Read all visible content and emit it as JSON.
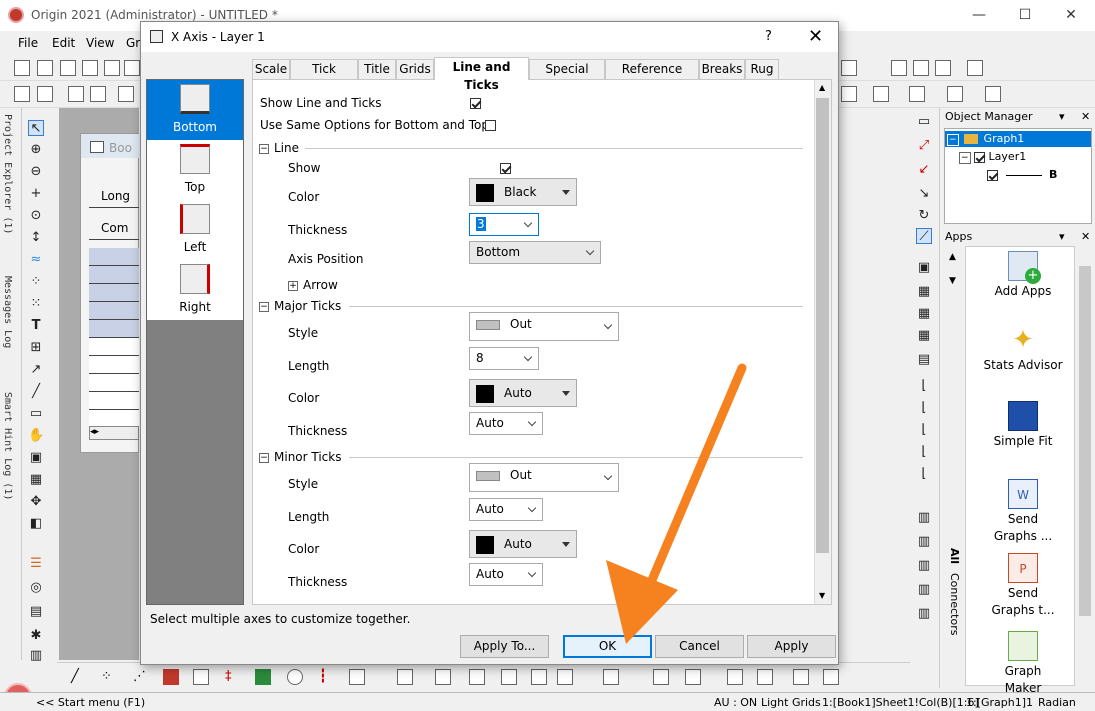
{
  "app": {
    "title": "Origin 2021 (Administrator) - UNTITLED *",
    "window_controls": [
      "—",
      "☐",
      "✕"
    ]
  },
  "menu": {
    "items": [
      "File",
      "Edit",
      "View",
      "Gra"
    ]
  },
  "vertical_tabs": [
    "Project Explorer (1)",
    "Messages Log",
    "Smart Hint Log (1)"
  ],
  "workbook": {
    "title": "Boo",
    "rows": [
      "Long",
      "Com"
    ]
  },
  "object_manager": {
    "title": "Object Manager",
    "controls": [
      "▾",
      "✕"
    ],
    "tree": {
      "graph": "Graph1",
      "layer": "Layer1",
      "plot": "B"
    }
  },
  "apps_panel": {
    "title": "Apps",
    "controls": [
      "▾",
      "✕"
    ],
    "tab_all": "All",
    "tab_connectors": "Connectors",
    "items": [
      "Add Apps",
      "Stats Advisor",
      "Simple Fit",
      "Send Graphs ...",
      "Send Graphs t...",
      "Graph Maker"
    ]
  },
  "status": {
    "start_menu": "<< Start menu (F1)",
    "au": "AU : ON",
    "grids": "Light Grids",
    "col": "1:[Book1]Sheet1!Col(B)[1:6]",
    "graph": "1:[Graph1]1",
    "units": "Radian"
  },
  "dialog": {
    "title": "X Axis - Layer 1",
    "help": "?",
    "close": "✕",
    "axes": [
      "Bottom",
      "Top",
      "Left",
      "Right"
    ],
    "selected_axis": "Bottom",
    "tabs": [
      "Scale",
      "Tick Labels",
      "Title",
      "Grids",
      "Line and Ticks",
      "Special Ticks",
      "Reference Lines",
      "Breaks",
      "Rug"
    ],
    "active_tab": "Line and Ticks",
    "options": {
      "show_line_and_ticks": "Show Line and Ticks",
      "same_options": "Use Same Options for Bottom and Top"
    },
    "line": {
      "section": "Line",
      "show_label": "Show",
      "color_label": "Color",
      "color_value": "Black",
      "thickness_label": "Thickness",
      "thickness_value": "3",
      "axis_position_label": "Axis Position",
      "axis_position_value": "Bottom",
      "arrow_label": "Arrow"
    },
    "major_ticks": {
      "section": "Major Ticks",
      "style_label": "Style",
      "style_value": "Out",
      "length_label": "Length",
      "length_value": "8",
      "color_label": "Color",
      "color_value": "Auto",
      "thickness_label": "Thickness",
      "thickness_value": "Auto"
    },
    "minor_ticks": {
      "section": "Minor Ticks",
      "style_label": "Style",
      "style_value": "Out",
      "length_label": "Length",
      "length_value": "Auto",
      "color_label": "Color",
      "color_value": "Auto",
      "thickness_label": "Thickness",
      "thickness_value": "Auto"
    },
    "hint": "Select multiple axes to customize together.",
    "buttons": {
      "apply_to": "Apply To...",
      "ok": "OK",
      "cancel": "Cancel",
      "apply": "Apply"
    }
  },
  "colors": {
    "selection": "#0078d7",
    "annotation_arrow": "#f5821f",
    "workspace": "#ababab"
  }
}
